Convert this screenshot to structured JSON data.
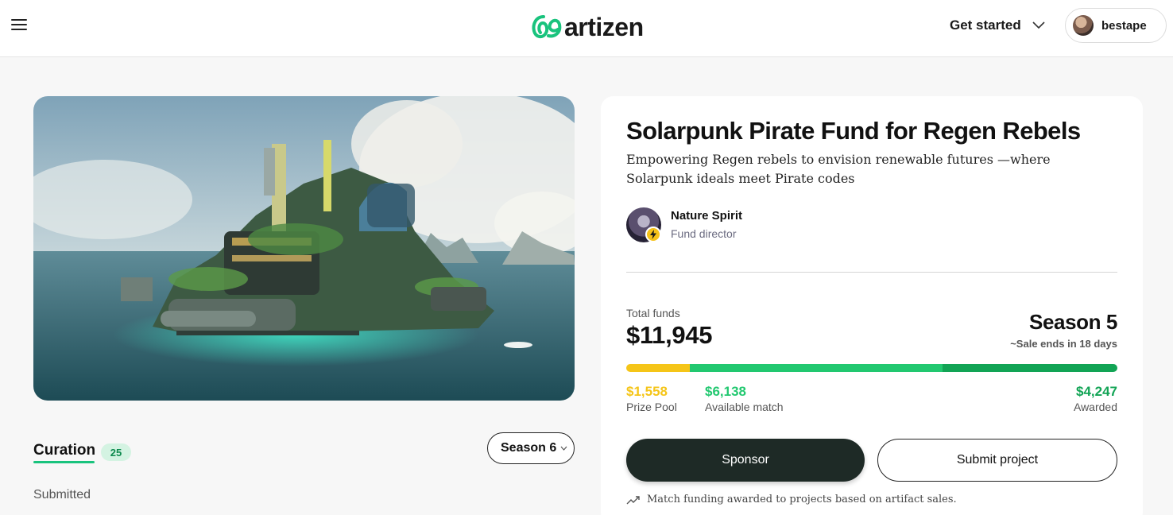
{
  "header": {
    "logo_text": "artizen",
    "get_started_label": "Get started",
    "user_name": "bestape"
  },
  "fund": {
    "title": "Solarpunk Pirate Fund for Regen Rebels",
    "description": "Empowering Regen rebels to envision renewable futures —where Solarpunk ideals meet Pirate codes",
    "director_name": "Nature Spirit",
    "director_role": "Fund director"
  },
  "funds": {
    "total_label": "Total funds",
    "total_value": "$11,945",
    "season_label": "Season 5",
    "sale_ends": "~Sale ends in 18 days",
    "prize_pool_value": "$1,558",
    "prize_pool_label": "Prize Pool",
    "available_match_value": "$6,138",
    "available_match_label": "Available match",
    "awarded_value": "$4,247",
    "awarded_label": "Awarded",
    "bar_fractions": {
      "prize_pool": 0.13,
      "available_match": 0.514,
      "awarded": 0.356
    },
    "colors": {
      "prize_pool": "#f5c518",
      "available_match": "#22c870",
      "awarded": "#12a455"
    }
  },
  "actions": {
    "sponsor_label": "Sponsor",
    "submit_label": "Submit project",
    "note": "Match funding awarded to projects based on artifact sales."
  },
  "curation": {
    "tab_label": "Curation",
    "count": "25",
    "season_select": "Season 6",
    "submitted_label": "Submitted"
  }
}
